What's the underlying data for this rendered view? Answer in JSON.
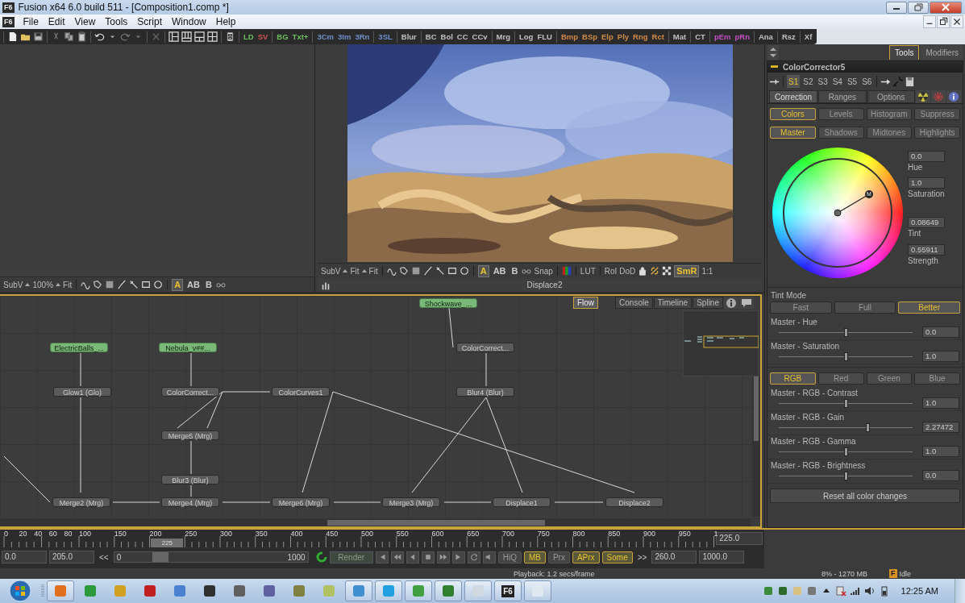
{
  "window": {
    "logo": "F6",
    "title": "Fusion x64 6.0 build 511 - [Composition1.comp *]"
  },
  "menu": {
    "logo": "F6",
    "items": [
      "File",
      "Edit",
      "View",
      "Tools",
      "Script",
      "Window",
      "Help"
    ]
  },
  "toolbar": {
    "tool_groups": [
      [
        {
          "label": "LD",
          "color": "#6cbf5c"
        },
        {
          "label": "SV",
          "color": "#d05050"
        }
      ],
      [
        {
          "label": "BG",
          "color": "#6cbf5c"
        },
        {
          "label": "Txt+",
          "color": "#6cbf5c"
        }
      ],
      [
        {
          "label": "3Cm",
          "color": "#6f8fc8"
        },
        {
          "label": "3Im",
          "color": "#6f8fc8"
        },
        {
          "label": "3Rn",
          "color": "#6f8fc8"
        }
      ],
      [
        {
          "label": "3SL",
          "color": "#6f8fc8"
        }
      ],
      [
        {
          "label": "Blur",
          "color": "#c0c0c0"
        }
      ],
      [
        {
          "label": "BC",
          "color": "#c0c0c0"
        },
        {
          "label": "Bol",
          "color": "#c0c0c0"
        },
        {
          "label": "CC",
          "color": "#c0c0c0"
        },
        {
          "label": "CCv",
          "color": "#c0c0c0"
        }
      ],
      [
        {
          "label": "Mrg",
          "color": "#c0c0c0"
        }
      ],
      [
        {
          "label": "Log",
          "color": "#c0c0c0"
        },
        {
          "label": "FLU",
          "color": "#c0c0c0"
        }
      ],
      [
        {
          "label": "Bmp",
          "color": "#d08a48"
        },
        {
          "label": "BSp",
          "color": "#d08a48"
        },
        {
          "label": "Elp",
          "color": "#d08a48"
        },
        {
          "label": "Ply",
          "color": "#d08a48"
        },
        {
          "label": "Rng",
          "color": "#d08a48"
        },
        {
          "label": "Rct",
          "color": "#d08a48"
        }
      ],
      [
        {
          "label": "Mat",
          "color": "#c0c0c0"
        }
      ],
      [
        {
          "label": "CT",
          "color": "#c0c0c0"
        }
      ],
      [
        {
          "label": "pEm",
          "color": "#c050c0"
        },
        {
          "label": "pRn",
          "color": "#c050c0"
        }
      ],
      [
        {
          "label": "Ana",
          "color": "#c0c0c0"
        }
      ],
      [
        {
          "label": "Rsz",
          "color": "#c0c0c0"
        }
      ],
      [
        {
          "label": "Xf",
          "color": "#c0c0c0"
        }
      ]
    ]
  },
  "viewer_left": {
    "menus": [
      "SubV",
      "100%"
    ],
    "fit": "Fit",
    "text_buttons": [
      {
        "label": "A",
        "selected": true
      },
      {
        "label": "AB",
        "selected": false
      },
      {
        "label": "B",
        "selected": false
      }
    ]
  },
  "viewer_right": {
    "menus": [
      "SubV",
      "Fit"
    ],
    "fit": "Fit",
    "text_buttons": [
      {
        "label": "A",
        "selected": true
      },
      {
        "label": "AB",
        "selected": false
      },
      {
        "label": "B",
        "selected": false
      }
    ],
    "snap": "Snap",
    "lut": "LUT",
    "roi": "RoI",
    "dod": "DoD",
    "smr": {
      "label": "SmR",
      "on": true
    },
    "ratio": "1:1",
    "view_name": "Displace2"
  },
  "flow": {
    "tabs": [
      {
        "label": "Flow",
        "selected": true
      },
      {
        "label": "Console",
        "selected": false
      },
      {
        "label": "Timeline",
        "selected": false
      },
      {
        "label": "Spline",
        "selected": false
      }
    ],
    "nodes": [
      {
        "label": "Shockwave_...",
        "kind": "loader"
      },
      {
        "label": "ElectricBalls_...",
        "kind": "loader"
      },
      {
        "label": "Nebula_v##...",
        "kind": "loader"
      },
      {
        "label": "ColorCorrect...",
        "kind": "tool"
      },
      {
        "label": "Glow1 (Glo)",
        "kind": "tool"
      },
      {
        "label": "ColorCorrect...",
        "kind": "tool"
      },
      {
        "label": "ColorCurves1",
        "kind": "tool"
      },
      {
        "label": "Blur4 (Blur)",
        "kind": "tool"
      },
      {
        "label": "Merge5 (Mrg)",
        "kind": "tool"
      },
      {
        "label": "Blur3 (Blur)",
        "kind": "tool"
      },
      {
        "label": "Merge2 (Mrg)",
        "kind": "tool"
      },
      {
        "label": "Merge4 (Mrg)",
        "kind": "tool"
      },
      {
        "label": "Merge6 (Mrg)",
        "kind": "tool"
      },
      {
        "label": "Merge3 (Mrg)",
        "kind": "tool"
      },
      {
        "label": "Displace1",
        "kind": "tool"
      },
      {
        "label": "Displace2",
        "kind": "tool"
      }
    ]
  },
  "inspector": {
    "panel_tabs": [
      {
        "label": "Tools",
        "selected": true
      },
      {
        "label": "Modifiers",
        "selected": false
      }
    ],
    "tool_name": "ColorCorrector5",
    "sets": [
      {
        "label": "S1",
        "selected": true
      },
      {
        "label": "S2",
        "selected": false
      },
      {
        "label": "S3",
        "selected": false
      },
      {
        "label": "S4",
        "selected": false
      },
      {
        "label": "S5",
        "selected": false
      },
      {
        "label": "S6",
        "selected": false
      }
    ],
    "tabs": [
      {
        "label": "Correction",
        "selected": true
      },
      {
        "label": "Ranges",
        "selected": false
      },
      {
        "label": "Options",
        "selected": false
      }
    ],
    "modes": [
      {
        "label": "Colors",
        "selected": true
      },
      {
        "label": "Levels",
        "selected": false
      },
      {
        "label": "Histogram",
        "selected": false
      },
      {
        "label": "Suppress",
        "selected": false
      }
    ],
    "ranges": [
      {
        "label": "Master",
        "selected": true
      },
      {
        "label": "Shadows",
        "selected": false
      },
      {
        "label": "Midtones",
        "selected": false
      },
      {
        "label": "Highlights",
        "selected": false
      }
    ],
    "wheel": {
      "handle": "M",
      "fields": [
        {
          "value": "0.0",
          "label": "Hue"
        },
        {
          "value": "1.0",
          "label": "Saturation"
        },
        {
          "value": "0.08649",
          "label": "Tint"
        },
        {
          "value": "0.55911",
          "label": "Strength"
        }
      ]
    },
    "tint_mode": {
      "label": "Tint Mode",
      "options": [
        {
          "label": "Fast",
          "selected": false
        },
        {
          "label": "Full",
          "selected": false
        },
        {
          "label": "Better",
          "selected": true
        }
      ]
    },
    "master_sliders": [
      {
        "label": "Master - Hue",
        "level": 0.5,
        "value": "0.0"
      },
      {
        "label": "Master - Saturation",
        "level": 0.5,
        "value": "1.0"
      }
    ],
    "channels": [
      {
        "label": "RGB",
        "selected": true
      },
      {
        "label": "Red",
        "selected": false
      },
      {
        "label": "Green",
        "selected": false
      },
      {
        "label": "Blue",
        "selected": false
      }
    ],
    "channel_sliders": [
      {
        "label": "Master - RGB - Contrast",
        "level": 0.5,
        "value": "1.0"
      },
      {
        "label": "Master - RGB - Gain",
        "level": 0.66,
        "value": "2.27472"
      },
      {
        "label": "Master - RGB - Gamma",
        "level": 0.5,
        "value": "1.0"
      },
      {
        "label": "Master - RGB - Brightness",
        "level": 0.5,
        "value": "0.0"
      }
    ],
    "reset": "Reset all color changes"
  },
  "timeline": {
    "ruler": [
      "0",
      "20",
      "40",
      "60",
      "80",
      "100",
      "150",
      "200",
      "250",
      "300",
      "350",
      "400",
      "450",
      "500",
      "550",
      "600",
      "650",
      "700",
      "750",
      "800",
      "850",
      "900",
      "950",
      "1"
    ],
    "playhead": {
      "label": "225",
      "level": 0.225
    },
    "current": "225.0",
    "start": "0.0",
    "render_start": "205.0",
    "back": "<<",
    "scrub": {
      "min": "0",
      "max": "1000",
      "level": 0.2
    },
    "render": "Render",
    "options": [
      {
        "label": "HiQ",
        "on": false
      },
      {
        "label": "MB",
        "on": true
      },
      {
        "label": "Prx",
        "on": false
      },
      {
        "label": "APrx",
        "on": true
      },
      {
        "label": "Some",
        "on": true
      }
    ],
    "forward": ">>",
    "render_end": "260.0",
    "end": "1000.0"
  },
  "status_bar": {
    "playback": "Playback: 1.2 secs/frame",
    "memory": "8% - 1270 MB",
    "badge": "F",
    "state": "Idle"
  },
  "taskbar": {
    "apps": [
      {
        "running": true
      },
      {
        "running": false
      },
      {
        "running": false
      },
      {
        "running": false
      },
      {
        "running": false
      },
      {
        "running": false
      },
      {
        "running": false
      },
      {
        "running": false
      },
      {
        "running": false
      },
      {
        "running": false
      },
      {
        "running": true
      },
      {
        "running": true
      },
      {
        "running": true
      },
      {
        "running": true
      },
      {
        "running": true
      },
      {
        "running": true,
        "label": "F6"
      },
      {
        "running": true
      }
    ],
    "clock": "12:25 AM"
  }
}
